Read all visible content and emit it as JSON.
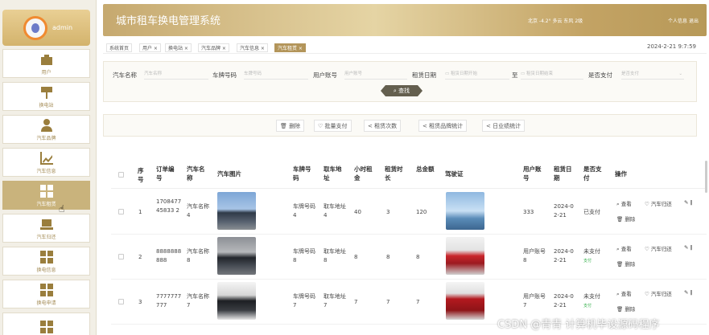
{
  "sidebar": {
    "admin_name": "admin",
    "items": [
      {
        "label": "用户",
        "icon": "briefcase-icon"
      },
      {
        "label": "换电站",
        "icon": "signpost-icon"
      },
      {
        "label": "汽车品牌",
        "icon": "person-icon"
      },
      {
        "label": "汽车信息",
        "icon": "chart-icon"
      },
      {
        "label": "汽车租赁",
        "icon": "grid-icon"
      },
      {
        "label": "汽车归还",
        "icon": "laptop-icon"
      },
      {
        "label": "换电信息",
        "icon": "grid-icon"
      },
      {
        "label": "换电申请",
        "icon": "grid-icon"
      },
      {
        "label": "",
        "icon": "grid-icon"
      }
    ]
  },
  "header": {
    "title": "城市租车换电管理系统",
    "weather": "北京  -4.2° 多云 东风 2级",
    "profile": "个人信息",
    "logout": "退出"
  },
  "tags": {
    "items": [
      "系统首页",
      "用户 ×",
      "换电站 ×",
      "汽车品牌 ×",
      "汽车信息 ×",
      "汽车租赁 ×"
    ],
    "datetime": "2024-2-21 9:7:59"
  },
  "search": {
    "car_name_label": "汽车名称",
    "car_name_ph": "汽车名称",
    "plate_label": "车牌号码",
    "plate_ph": "车牌号码",
    "account_label": "用户账号",
    "account_ph": "用户账号",
    "date_label": "租赁日期",
    "date_start_ph": "租赁日期开始",
    "date_to": "至",
    "date_end_ph": "租赁日期结束",
    "paid_label": "是否支付",
    "paid_ph": "是否支付",
    "button": "查找"
  },
  "actions": {
    "delete": "删除",
    "batch_pay": "批量支付",
    "rent_count": "租赁次数",
    "brand_stats": "租赁品牌统计",
    "perf_stats": "日业绩统计"
  },
  "table": {
    "headers": {
      "no": "序号",
      "order": "订单编号",
      "car_name": "汽车名称",
      "car_img": "汽车图片",
      "plate": "车牌号码",
      "station": "取车地址",
      "hourly": "小时租金",
      "duration": "租赁时长",
      "total": "总金额",
      "license": "驾驶证",
      "account": "用户账号",
      "date": "租赁日期",
      "paid": "是否支付",
      "ops": "操作"
    },
    "ops": {
      "view": "查看",
      "return": "汽车归还",
      "delete": "删除"
    },
    "rows": [
      {
        "no": "1",
        "order": "170847745833 2",
        "car_name": "汽车名称4",
        "plate": "车牌号码4",
        "station": "取车地址4",
        "hourly": "40",
        "duration": "3",
        "total": "120",
        "account": "333",
        "date": "2024-02-21",
        "paid": "已支付",
        "pay_link": ""
      },
      {
        "no": "2",
        "order": "8888888888",
        "car_name": "汽车名称8",
        "plate": "车牌号码8",
        "station": "取车地址8",
        "hourly": "8",
        "duration": "8",
        "total": "8",
        "account": "用户账号8",
        "date": "2024-02-21",
        "paid": "未支付",
        "pay_link": "支付"
      },
      {
        "no": "3",
        "order": "7777777777",
        "car_name": "汽车名称7",
        "plate": "车牌号码7",
        "station": "取车地址7",
        "hourly": "7",
        "duration": "7",
        "total": "7",
        "account": "用户账号7",
        "date": "2024-02-21",
        "paid": "未支付",
        "pay_link": "支付"
      }
    ]
  },
  "watermark": "CSDN @青青  计算机毕设源码程序"
}
